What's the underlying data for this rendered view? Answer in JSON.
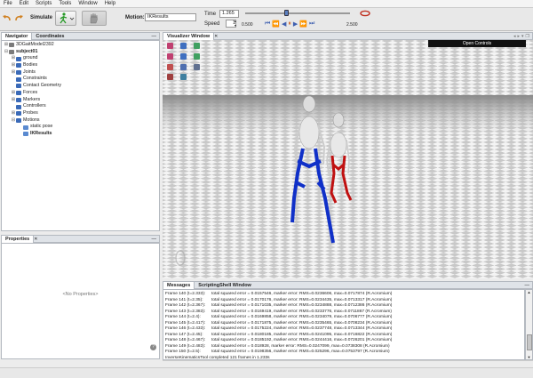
{
  "menu": [
    "File",
    "Edit",
    "Scripts",
    "Tools",
    "Window",
    "Help"
  ],
  "toolbar": {
    "simulate_label": "Simulate",
    "motion_label": "Motion:",
    "motion_value": "IKResults",
    "time_label": "Time",
    "time_value": "1.265",
    "speed_label": "Speed",
    "speed_value": "1",
    "range_start": "0.500",
    "range_end": "2.500"
  },
  "navigator": {
    "tabs": [
      "Navigator",
      "Coordinates"
    ],
    "items": [
      {
        "label": "3DGaitModel2392",
        "level": 0,
        "exp": "⊞",
        "bold": false
      },
      {
        "label": "subject01",
        "level": 0,
        "exp": "⊟",
        "bold": true
      },
      {
        "label": "ground",
        "level": 1,
        "exp": "⊞",
        "bold": false
      },
      {
        "label": "Bodies",
        "level": 1,
        "exp": "⊞",
        "bold": false
      },
      {
        "label": "Joints",
        "level": 1,
        "exp": "⊞",
        "bold": false
      },
      {
        "label": "Constraints",
        "level": 1,
        "exp": "",
        "bold": false
      },
      {
        "label": "Contact Geometry",
        "level": 1,
        "exp": "",
        "bold": false
      },
      {
        "label": "Forces",
        "level": 1,
        "exp": "⊞",
        "bold": false
      },
      {
        "label": "Markers",
        "level": 1,
        "exp": "⊞",
        "bold": false
      },
      {
        "label": "Controllers",
        "level": 1,
        "exp": "",
        "bold": false
      },
      {
        "label": "Probes",
        "level": 1,
        "exp": "⊞",
        "bold": false
      },
      {
        "label": "Motions",
        "level": 1,
        "exp": "⊟",
        "bold": false
      },
      {
        "label": "static pose",
        "level": 2,
        "exp": "",
        "bold": false
      },
      {
        "label": "IKResults",
        "level": 2,
        "exp": "",
        "bold": true
      }
    ]
  },
  "properties": {
    "tab": "Properties",
    "empty": "<No Properties>"
  },
  "visualizer": {
    "tab": "Visualizer Window",
    "open_controls": "Open Controls"
  },
  "messages": {
    "tabs": [
      "Messages",
      "ScriptingShell Window"
    ],
    "lines": [
      {
        "frame": "Frame 140 (t=2.333):",
        "text": "total squared error = 0.0157546, marker error: RMS=0.0236606, max=0.0717874 (R.Acromium)"
      },
      {
        "frame": "Frame 141 (t=2.35):",
        "text": "total squared error = 0.0170176, marker error: RMS=0.0234435, max=0.0713317 (R.Acromium)"
      },
      {
        "frame": "Frame 142 (t=2.367):",
        "text": "total squared error = 0.0171035, marker error: RMS=0.0234888, max=0.0712386 (R.Acromium)"
      },
      {
        "frame": "Frame 143 (t=2.383):",
        "text": "total squared error = 0.0169419, marker error: RMS=0.0233776, max=0.0711867 (R.Acromium)"
      },
      {
        "frame": "Frame 144 (t=2.4):",
        "text": "total squared error = 0.0169858, marker error: RMS=0.0234079, max=0.0706777 (R.Acromium)"
      },
      {
        "frame": "Frame 145 (t=2.417):",
        "text": "total squared error = 0.0171875, marker error: RMS=0.0235465, max=0.0708234 (R.Acromium)"
      },
      {
        "frame": "Frame 146 (t=2.433):",
        "text": "total squared error = 0.0175224, marker error: RMS=0.0237748, max=0.0713344 (R.Acromium)"
      },
      {
        "frame": "Frame 147 (t=2.45):",
        "text": "total squared error = 0.0180185, marker error: RMS=0.0241095, max=0.0716822 (R.Acromium)"
      },
      {
        "frame": "Frame 148 (t=2.467):",
        "text": "total squared error = 0.0185192, marker error: RMS=0.0244416, max=0.0726201 (R.Acromium)"
      },
      {
        "frame": "Frame 149 (t=2.483):",
        "text": "total squared error = 0.018928, marker error: RMS=0.0247099, max=0.0738308 (R.Acromium)"
      },
      {
        "frame": "Frame 150 (t=2.5):",
        "text": "total squared error = 0.0198356, marker error: RMS=0.025296, max=0.0753797 (R.Acromium)"
      },
      {
        "frame": "InverseKinematicsTool completed 121 frames in 1.233s",
        "text": ""
      }
    ]
  },
  "colors": {
    "accent": "#e06020",
    "blue_model": "#1030c8",
    "red_model": "#c01010"
  }
}
